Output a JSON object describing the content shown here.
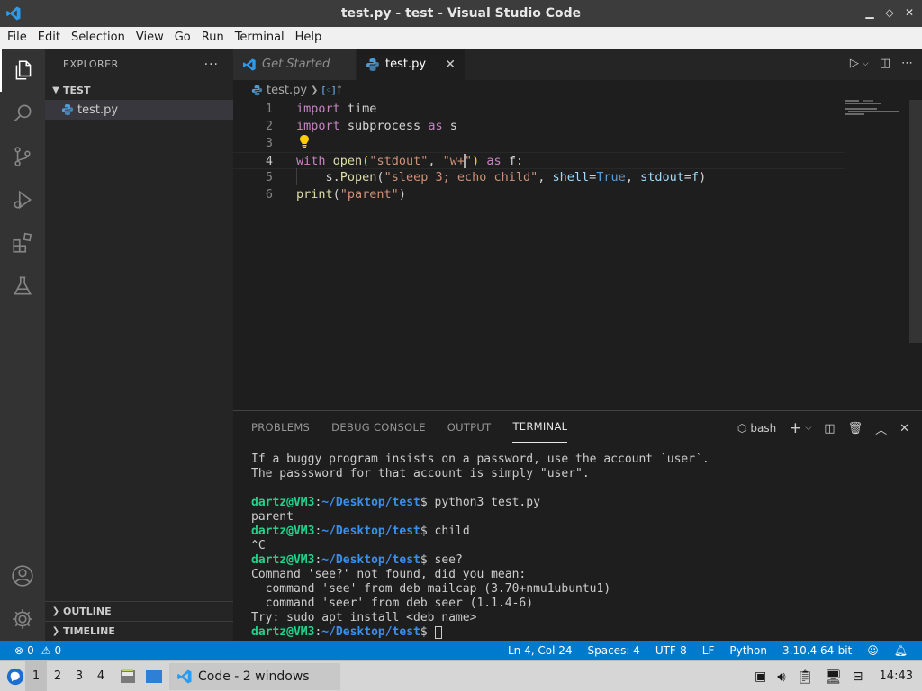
{
  "window": {
    "title": "test.py - test - Visual Studio Code"
  },
  "menu": [
    "File",
    "Edit",
    "Selection",
    "View",
    "Go",
    "Run",
    "Terminal",
    "Help"
  ],
  "sidebar": {
    "header": "EXPLORER",
    "more": "···",
    "folder": "TEST",
    "file": "test.py",
    "outline": "OUTLINE",
    "timeline": "TIMELINE"
  },
  "tabs": [
    {
      "label": "Get Started",
      "active": false
    },
    {
      "label": "test.py",
      "active": true,
      "close": "✕"
    }
  ],
  "breadcrumb": {
    "file": "test.py",
    "symbol": "f"
  },
  "editor": {
    "line_numbers": [
      "1",
      "2",
      "3",
      "4",
      "5",
      "6"
    ],
    "lines": [
      {
        "parts": [
          [
            "kw",
            "import"
          ],
          [
            "",
            " time"
          ]
        ]
      },
      {
        "parts": [
          [
            "kw",
            "import"
          ],
          [
            "",
            " subprocess "
          ],
          [
            "kw",
            "as"
          ],
          [
            "",
            " s"
          ]
        ]
      },
      {
        "parts": []
      },
      {
        "parts": [
          [
            "kw",
            "with"
          ],
          [
            "",
            " "
          ],
          [
            "fn",
            "open"
          ],
          [
            "bracket",
            "("
          ],
          [
            "str",
            "\"stdout\""
          ],
          [
            "",
            ", "
          ],
          [
            "str",
            "\"w+"
          ],
          [
            "cursor",
            ""
          ],
          [
            "str",
            "\""
          ],
          [
            "bracket",
            ")"
          ],
          [
            "",
            " "
          ],
          [
            "kw",
            "as"
          ],
          [
            "",
            " f:"
          ]
        ]
      },
      {
        "parts": [
          [
            "",
            "    s."
          ],
          [
            "fn",
            "Popen"
          ],
          [
            "",
            "("
          ],
          [
            "str",
            "\"sleep 3; echo child\""
          ],
          [
            "",
            ", "
          ],
          [
            "var",
            "shell"
          ],
          [
            "",
            "="
          ],
          [
            "bool",
            "True"
          ],
          [
            "",
            ", "
          ],
          [
            "var",
            "stdout"
          ],
          [
            "",
            "="
          ],
          [
            "var",
            "f"
          ],
          [
            "",
            ")"
          ]
        ]
      },
      {
        "parts": [
          [
            "fn",
            "print"
          ],
          [
            "",
            "("
          ],
          [
            "str",
            "\"parent\""
          ],
          [
            "",
            ")"
          ]
        ]
      }
    ]
  },
  "panel": {
    "tabs": [
      "PROBLEMS",
      "DEBUG CONSOLE",
      "OUTPUT",
      "TERMINAL"
    ],
    "active_tab": "TERMINAL",
    "shell": "bash",
    "terminal": [
      {
        "text": "If a buggy program insists on a password, use the account `user`."
      },
      {
        "text": "The passsword for that account is simply \"user\"."
      },
      {
        "text": ""
      },
      {
        "user": "dartz@VM3",
        "path": "~/Desktop/test",
        "cmd": "$ python3 test.py"
      },
      {
        "text": "parent"
      },
      {
        "user": "dartz@VM3",
        "path": "~/Desktop/test",
        "cmd": "$ child"
      },
      {
        "text": "^C"
      },
      {
        "user": "dartz@VM3",
        "path": "~/Desktop/test",
        "cmd": "$ see?"
      },
      {
        "text": "Command 'see?' not found, did you mean:"
      },
      {
        "text": "  command 'see' from deb mailcap (3.70+nmu1ubuntu1)"
      },
      {
        "text": "  command 'seer' from deb seer (1.1.4-6)"
      },
      {
        "text": "Try: sudo apt install <deb name>"
      },
      {
        "user": "dartz@VM3",
        "path": "~/Desktop/test",
        "cmd": "$ ",
        "cursor": true
      }
    ]
  },
  "statusbar": {
    "errors": "0",
    "warnings": "0",
    "position": "Ln 4, Col 24",
    "spaces": "Spaces: 4",
    "encoding": "UTF-8",
    "eol": "LF",
    "language": "Python",
    "interpreter": "3.10.4 64-bit"
  },
  "taskbar": {
    "workspaces": [
      "1",
      "2",
      "3",
      "4"
    ],
    "task_label": "Code - 2 windows",
    "clock": "14:43"
  },
  "colors": {
    "accent": "#007acc",
    "activity_bar": "#333333",
    "sidebar": "#252526",
    "editor": "#1e1e1e"
  }
}
